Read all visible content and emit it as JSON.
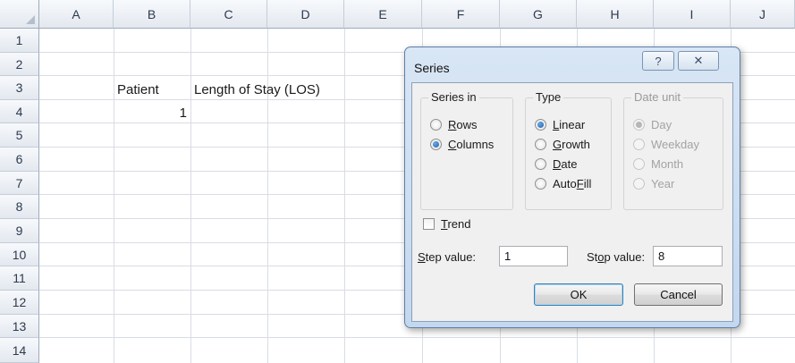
{
  "sheet": {
    "columns": [
      "A",
      "B",
      "C",
      "D",
      "E",
      "F",
      "G",
      "H",
      "I",
      "J"
    ],
    "rows": [
      "1",
      "2",
      "3",
      "4",
      "5",
      "6",
      "7",
      "8",
      "9",
      "10",
      "11",
      "12",
      "13",
      "14"
    ],
    "cells": {
      "b3": "Patient",
      "c3": "Length of Stay (LOS)",
      "b4": "1"
    }
  },
  "dialog": {
    "title": "Series",
    "help_glyph": "?",
    "close_glyph": "✕",
    "series_in": {
      "label": "Series in",
      "options": [
        {
          "label": "Rows",
          "underline": "R",
          "rest": "ows",
          "checked": false
        },
        {
          "label": "Columns",
          "underline": "C",
          "rest": "olumns",
          "checked": true
        }
      ]
    },
    "type": {
      "label": "Type",
      "options": [
        {
          "label": "Linear",
          "underline": "L",
          "rest": "inear",
          "checked": true
        },
        {
          "label": "Growth",
          "underline": "G",
          "rest": "rowth",
          "checked": false
        },
        {
          "label": "Date",
          "underline": "D",
          "rest": "ate",
          "checked": false
        },
        {
          "label": "AutoFill",
          "pre": "Auto",
          "underline": "F",
          "rest": "ill",
          "checked": false
        }
      ]
    },
    "date_unit": {
      "label": "Date unit",
      "disabled": true,
      "options": [
        {
          "label": "Day",
          "checked": true
        },
        {
          "label": "Weekday",
          "checked": false
        },
        {
          "label": "Month",
          "checked": false
        },
        {
          "label": "Year",
          "checked": false
        }
      ]
    },
    "trend": {
      "underline": "T",
      "rest": "rend",
      "checked": false
    },
    "step": {
      "underline": "S",
      "rest": "tep value:",
      "value": "1"
    },
    "stop": {
      "pre": "St",
      "underline": "o",
      "rest": "p value:",
      "value": "8"
    },
    "ok_label": "OK",
    "cancel_label": "Cancel"
  }
}
